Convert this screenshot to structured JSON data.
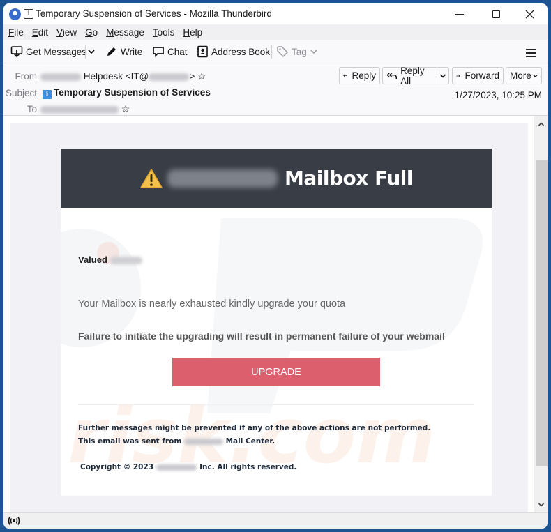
{
  "window": {
    "title": "Temporary Suspension of Services - Mozilla Thunderbird",
    "controls": [
      "minimize",
      "maximize",
      "close"
    ]
  },
  "menubar": {
    "items": [
      {
        "label": "File",
        "accesskey": "F"
      },
      {
        "label": "Edit",
        "accesskey": "E"
      },
      {
        "label": "View",
        "accesskey": "V"
      },
      {
        "label": "Go",
        "accesskey": "G"
      },
      {
        "label": "Message",
        "accesskey": "M"
      },
      {
        "label": "Tools",
        "accesskey": "T"
      },
      {
        "label": "Help",
        "accesskey": "H"
      }
    ]
  },
  "toolbar": {
    "get_messages": "Get Messages",
    "write": "Write",
    "chat": "Chat",
    "address_book": "Address Book",
    "tag": "Tag",
    "icons": {
      "get_messages": "download-tray-icon",
      "write": "pencil-icon",
      "chat": "speech-bubble-icon",
      "address_book": "address-book-icon",
      "tag": "tag-icon",
      "menu": "hamburger-menu-icon"
    }
  },
  "header": {
    "from_label": "From",
    "from_name": "Helpdesk <IT@",
    "from_suffix": ">",
    "subject_label": "Subject",
    "subject": "Temporary Suspension of Services",
    "to_label": "To",
    "date": "1/27/2023, 10:25 PM",
    "buttons": {
      "reply": "Reply",
      "reply_all": "Reply All",
      "forward": "Forward",
      "more": "More"
    }
  },
  "email": {
    "banner_title": "Mailbox Full",
    "greeting": "Valued",
    "line1": "Your Mailbox is nearly exhausted kindly upgrade your quota",
    "line2": "Failure to initiate the upgrading will result in permanent failure of your webmail",
    "button": "UPGRADE",
    "footer1": "Further messages might be prevented if any of the above actions are not performed.",
    "footer2_prefix": "This email was sent from",
    "footer2_suffix": "Mail Center.",
    "copyright_prefix": "Copyright © 2023",
    "copyright_suffix": "Inc. All rights reserved.",
    "colors": {
      "banner_bg": "#393e46",
      "button_bg": "#dc5f6d",
      "warning": "#f2c14e"
    }
  },
  "statusbar": {
    "icon": "activity-broadcast-icon"
  }
}
